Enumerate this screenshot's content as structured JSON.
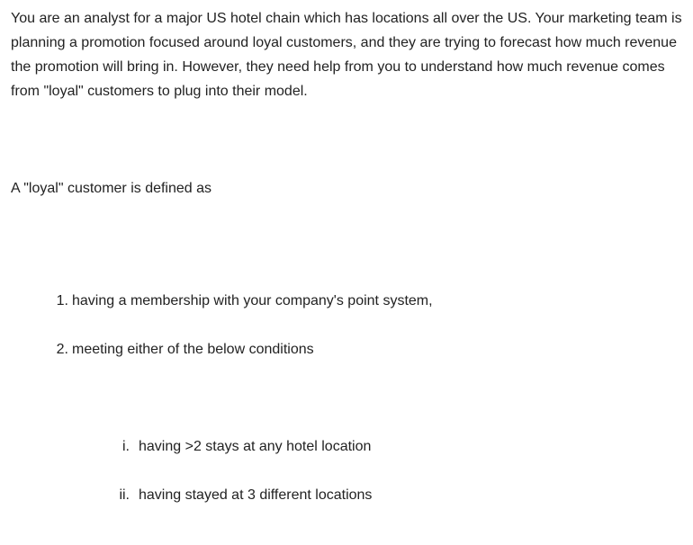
{
  "intro": "You are an analyst for a major US hotel chain which has locations all over the US. Your marketing team is planning a promotion focused around loyal customers, and they are trying to forecast how much revenue the promotion will bring in. However, they need help from you to understand how much revenue comes from \"loyal\" customers to plug into their model.",
  "definition": "A \"loyal\" customer is defined as",
  "conditions": [
    {
      "marker": "1.",
      "text": "having a membership with your company's point system,"
    },
    {
      "marker": "2.",
      "text": "meeting either of the below conditions"
    }
  ],
  "sub_conditions": [
    {
      "marker": "i.",
      "text": "having >2 stays at any hotel location"
    },
    {
      "marker": "ii.",
      "text": "having stayed at 3 different locations"
    }
  ]
}
